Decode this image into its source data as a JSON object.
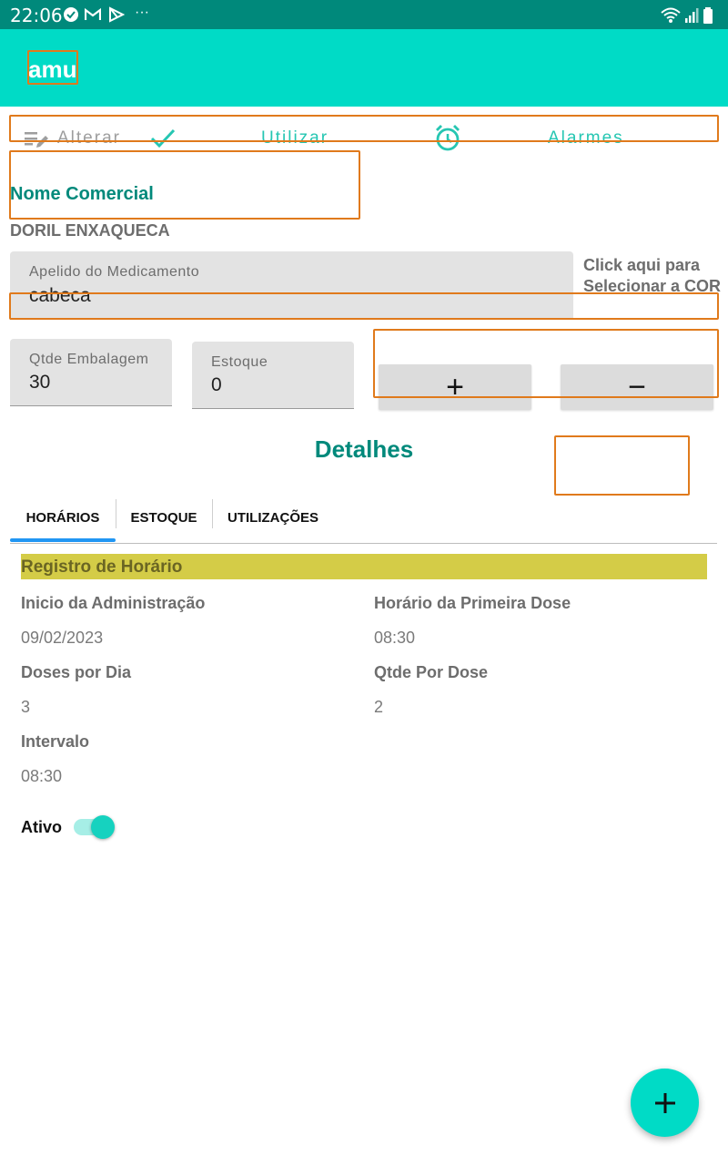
{
  "status_bar": {
    "time": "22:06",
    "icons": [
      "check-circle-icon",
      "gmail-icon",
      "play-store-icon",
      "more-dots-icon"
    ],
    "right_icons": [
      "wifi-icon",
      "signal-icon",
      "battery-icon"
    ],
    "dots": "···"
  },
  "app_bar": {
    "title": "amu",
    "color": "#00dbc6"
  },
  "toolbar": {
    "alterar_label": "Alterar",
    "utilizar_label": "Utilizar",
    "alarmes_label": "Alarmes"
  },
  "medication": {
    "nome_comercial_label": "Nome Comercial",
    "name": "DORIL ENXAQUECA",
    "apelido_label": "Apelido do Medicamento",
    "apelido_value": "cabeca",
    "color_hint_line1": "Click aqui para",
    "color_hint_line2": "Selecionar a COR",
    "qtde_label": "Qtde Embalagem",
    "qtde_value": "30",
    "estoque_label": "Estoque",
    "estoque_value": "0",
    "plus_label": "+",
    "minus_label": "−"
  },
  "detalhes": {
    "title": "Detalhes",
    "tabs": [
      {
        "label": "HORÁRIOS"
      },
      {
        "label": "ESTOQUE"
      },
      {
        "label": "UTILIZAÇÕES"
      }
    ]
  },
  "registro": {
    "header": "Registro de Horário",
    "inicio_label": "Inicio da Administração",
    "inicio_value": "09/02/2023",
    "primeira_dose_label": "Horário da Primeira Dose",
    "primeira_dose_value": "08:30",
    "doses_label": "Doses por Dia",
    "doses_value": "3",
    "qtde_dose_label": "Qtde Por Dose",
    "qtde_dose_value": "2",
    "intervalo_label": "Intervalo",
    "intervalo_value": "08:30",
    "ativo_label": "Ativo",
    "ativo_on": true
  },
  "colors": {
    "primary": "#00dbc6",
    "primary_dark": "#00897b",
    "accent_text": "#00897b",
    "highlight": "#d4cc47"
  }
}
